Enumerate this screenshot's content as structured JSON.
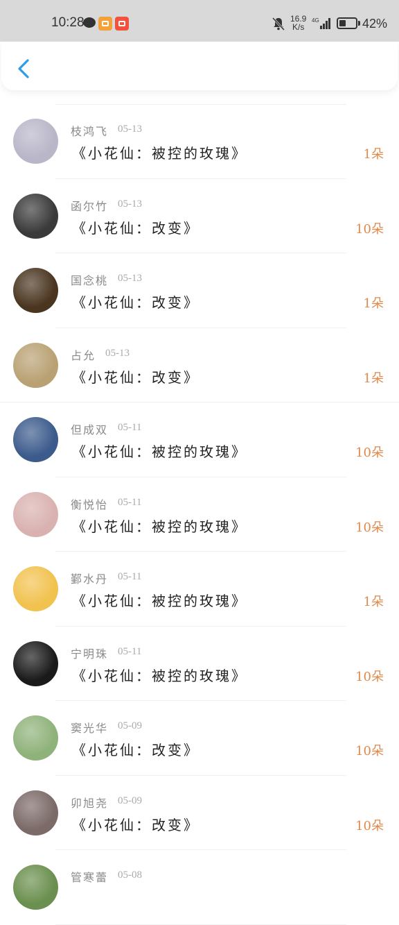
{
  "status_bar": {
    "time": "10:28",
    "net_speed_value": "16.9",
    "net_speed_unit": "K/s",
    "network": "4G",
    "battery": "42%",
    "battery_level": 0.42
  },
  "header": {
    "back_icon": "chevron-left-icon",
    "accent_color": "#2b9de8"
  },
  "gifts": [
    {
      "name": "枝鸿飞",
      "date": "05-13",
      "title": "《小花仙：被控的玫瑰》",
      "amount": "1朵",
      "avatar_color": "#b9b6c9"
    },
    {
      "name": "函尔竹",
      "date": "05-13",
      "title": "《小花仙：改变》",
      "amount": "10朵",
      "avatar_color": "#3a3a3a"
    },
    {
      "name": "国念桃",
      "date": "05-13",
      "title": "《小花仙：改变》",
      "amount": "1朵",
      "avatar_color": "#4a3520"
    },
    {
      "name": "占允",
      "date": "05-13",
      "title": "《小花仙：改变》",
      "amount": "1朵",
      "avatar_color": "#b9a173"
    },
    {
      "name": "但成双",
      "date": "05-11",
      "title": "《小花仙：被控的玫瑰》",
      "amount": "10朵",
      "avatar_color": "#3c5b8c"
    },
    {
      "name": "衡悦怡",
      "date": "05-11",
      "title": "《小花仙：被控的玫瑰》",
      "amount": "10朵",
      "avatar_color": "#d9b2b0"
    },
    {
      "name": "鄞水丹",
      "date": "05-11",
      "title": "《小花仙：被控的玫瑰》",
      "amount": "1朵",
      "avatar_color": "#f2c24f"
    },
    {
      "name": "宁明珠",
      "date": "05-11",
      "title": "《小花仙：被控的玫瑰》",
      "amount": "10朵",
      "avatar_color": "#1a1a1a"
    },
    {
      "name": "窦光华",
      "date": "05-09",
      "title": "《小花仙：改变》",
      "amount": "10朵",
      "avatar_color": "#8fb27a"
    },
    {
      "name": "卯旭尧",
      "date": "05-09",
      "title": "《小花仙：改变》",
      "amount": "10朵",
      "avatar_color": "#7b6a68"
    },
    {
      "name": "管寒蕾",
      "date": "05-08",
      "title": "",
      "amount": "",
      "avatar_color": "#6a8f4e"
    }
  ],
  "colors": {
    "amount": "#e0894a",
    "name": "#8a8a8a",
    "date": "#aaaaaa",
    "title": "#222222"
  }
}
